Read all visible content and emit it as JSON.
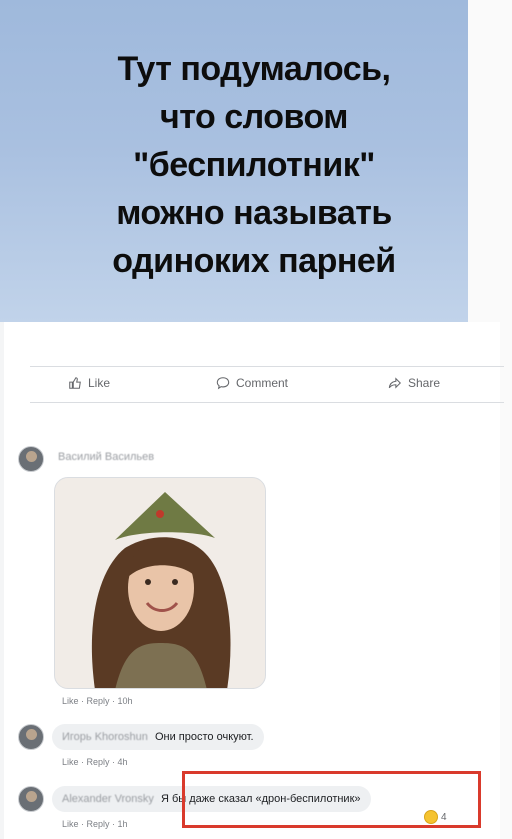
{
  "post": {
    "lines": [
      "Тут подумалось,",
      "что словом",
      "\"беспилотник\"",
      "можно называть",
      "одиноких парней"
    ]
  },
  "actions": {
    "like": "Like",
    "comment": "Comment",
    "share": "Share"
  },
  "comments": [
    {
      "author": "Василий Васильев",
      "text": "",
      "has_photo": true,
      "meta": "Like · Reply · 10h"
    },
    {
      "author": "Игорь Khoroshun",
      "text": "Они просто очкуют.",
      "meta": "Like · Reply · 4h"
    },
    {
      "author": "Alexander Vronsky",
      "text": "Я бы даже сказал «дрон-беспилотник»",
      "meta": "Like · Reply · 1h",
      "reaction_count": "4"
    }
  ],
  "colors": {
    "post_bg": "#a9c0e0",
    "highlight": "#d93a2c"
  }
}
